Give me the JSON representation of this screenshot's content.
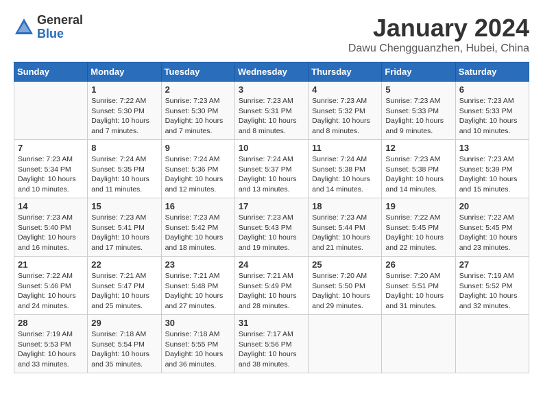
{
  "logo": {
    "general": "General",
    "blue": "Blue"
  },
  "title": "January 2024",
  "subtitle": "Dawu Chengguanzhen, Hubei, China",
  "weekdays": [
    "Sunday",
    "Monday",
    "Tuesday",
    "Wednesday",
    "Thursday",
    "Friday",
    "Saturday"
  ],
  "weeks": [
    [
      {
        "day": "",
        "info": ""
      },
      {
        "day": "1",
        "info": "Sunrise: 7:22 AM\nSunset: 5:30 PM\nDaylight: 10 hours\nand 7 minutes."
      },
      {
        "day": "2",
        "info": "Sunrise: 7:23 AM\nSunset: 5:30 PM\nDaylight: 10 hours\nand 7 minutes."
      },
      {
        "day": "3",
        "info": "Sunrise: 7:23 AM\nSunset: 5:31 PM\nDaylight: 10 hours\nand 8 minutes."
      },
      {
        "day": "4",
        "info": "Sunrise: 7:23 AM\nSunset: 5:32 PM\nDaylight: 10 hours\nand 8 minutes."
      },
      {
        "day": "5",
        "info": "Sunrise: 7:23 AM\nSunset: 5:33 PM\nDaylight: 10 hours\nand 9 minutes."
      },
      {
        "day": "6",
        "info": "Sunrise: 7:23 AM\nSunset: 5:33 PM\nDaylight: 10 hours\nand 10 minutes."
      }
    ],
    [
      {
        "day": "7",
        "info": "Sunrise: 7:23 AM\nSunset: 5:34 PM\nDaylight: 10 hours\nand 10 minutes."
      },
      {
        "day": "8",
        "info": "Sunrise: 7:24 AM\nSunset: 5:35 PM\nDaylight: 10 hours\nand 11 minutes."
      },
      {
        "day": "9",
        "info": "Sunrise: 7:24 AM\nSunset: 5:36 PM\nDaylight: 10 hours\nand 12 minutes."
      },
      {
        "day": "10",
        "info": "Sunrise: 7:24 AM\nSunset: 5:37 PM\nDaylight: 10 hours\nand 13 minutes."
      },
      {
        "day": "11",
        "info": "Sunrise: 7:24 AM\nSunset: 5:38 PM\nDaylight: 10 hours\nand 14 minutes."
      },
      {
        "day": "12",
        "info": "Sunrise: 7:23 AM\nSunset: 5:38 PM\nDaylight: 10 hours\nand 14 minutes."
      },
      {
        "day": "13",
        "info": "Sunrise: 7:23 AM\nSunset: 5:39 PM\nDaylight: 10 hours\nand 15 minutes."
      }
    ],
    [
      {
        "day": "14",
        "info": "Sunrise: 7:23 AM\nSunset: 5:40 PM\nDaylight: 10 hours\nand 16 minutes."
      },
      {
        "day": "15",
        "info": "Sunrise: 7:23 AM\nSunset: 5:41 PM\nDaylight: 10 hours\nand 17 minutes."
      },
      {
        "day": "16",
        "info": "Sunrise: 7:23 AM\nSunset: 5:42 PM\nDaylight: 10 hours\nand 18 minutes."
      },
      {
        "day": "17",
        "info": "Sunrise: 7:23 AM\nSunset: 5:43 PM\nDaylight: 10 hours\nand 19 minutes."
      },
      {
        "day": "18",
        "info": "Sunrise: 7:23 AM\nSunset: 5:44 PM\nDaylight: 10 hours\nand 21 minutes."
      },
      {
        "day": "19",
        "info": "Sunrise: 7:22 AM\nSunset: 5:45 PM\nDaylight: 10 hours\nand 22 minutes."
      },
      {
        "day": "20",
        "info": "Sunrise: 7:22 AM\nSunset: 5:45 PM\nDaylight: 10 hours\nand 23 minutes."
      }
    ],
    [
      {
        "day": "21",
        "info": "Sunrise: 7:22 AM\nSunset: 5:46 PM\nDaylight: 10 hours\nand 24 minutes."
      },
      {
        "day": "22",
        "info": "Sunrise: 7:21 AM\nSunset: 5:47 PM\nDaylight: 10 hours\nand 25 minutes."
      },
      {
        "day": "23",
        "info": "Sunrise: 7:21 AM\nSunset: 5:48 PM\nDaylight: 10 hours\nand 27 minutes."
      },
      {
        "day": "24",
        "info": "Sunrise: 7:21 AM\nSunset: 5:49 PM\nDaylight: 10 hours\nand 28 minutes."
      },
      {
        "day": "25",
        "info": "Sunrise: 7:20 AM\nSunset: 5:50 PM\nDaylight: 10 hours\nand 29 minutes."
      },
      {
        "day": "26",
        "info": "Sunrise: 7:20 AM\nSunset: 5:51 PM\nDaylight: 10 hours\nand 31 minutes."
      },
      {
        "day": "27",
        "info": "Sunrise: 7:19 AM\nSunset: 5:52 PM\nDaylight: 10 hours\nand 32 minutes."
      }
    ],
    [
      {
        "day": "28",
        "info": "Sunrise: 7:19 AM\nSunset: 5:53 PM\nDaylight: 10 hours\nand 33 minutes."
      },
      {
        "day": "29",
        "info": "Sunrise: 7:18 AM\nSunset: 5:54 PM\nDaylight: 10 hours\nand 35 minutes."
      },
      {
        "day": "30",
        "info": "Sunrise: 7:18 AM\nSunset: 5:55 PM\nDaylight: 10 hours\nand 36 minutes."
      },
      {
        "day": "31",
        "info": "Sunrise: 7:17 AM\nSunset: 5:56 PM\nDaylight: 10 hours\nand 38 minutes."
      },
      {
        "day": "",
        "info": ""
      },
      {
        "day": "",
        "info": ""
      },
      {
        "day": "",
        "info": ""
      }
    ]
  ]
}
